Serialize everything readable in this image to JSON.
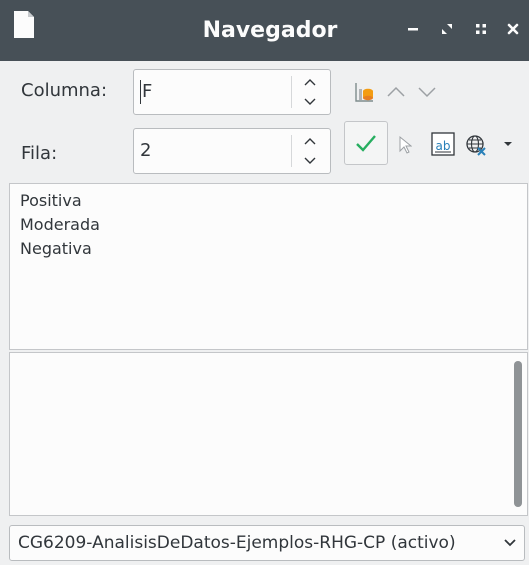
{
  "window": {
    "title": "Navegador",
    "titlebar_color": "#475057"
  },
  "column": {
    "label": "Columna:",
    "value": "F"
  },
  "row": {
    "label": "Fila:",
    "value": "2"
  },
  "toolbar": {
    "icons": [
      "data-range-icon",
      "chevron-up-icon",
      "chevron-down-icon",
      "checkmark-icon",
      "pointer-icon",
      "text-box-icon",
      "globe-icon",
      "dropdown-arrow-icon"
    ],
    "accent": "#27ae60"
  },
  "scenarios": {
    "items": [
      "Positiva",
      "Moderada",
      "Negativa"
    ]
  },
  "document": {
    "selected": "CG6209-AnalisisDeDatos-Ejemplos-RHG-CP (activo)"
  }
}
